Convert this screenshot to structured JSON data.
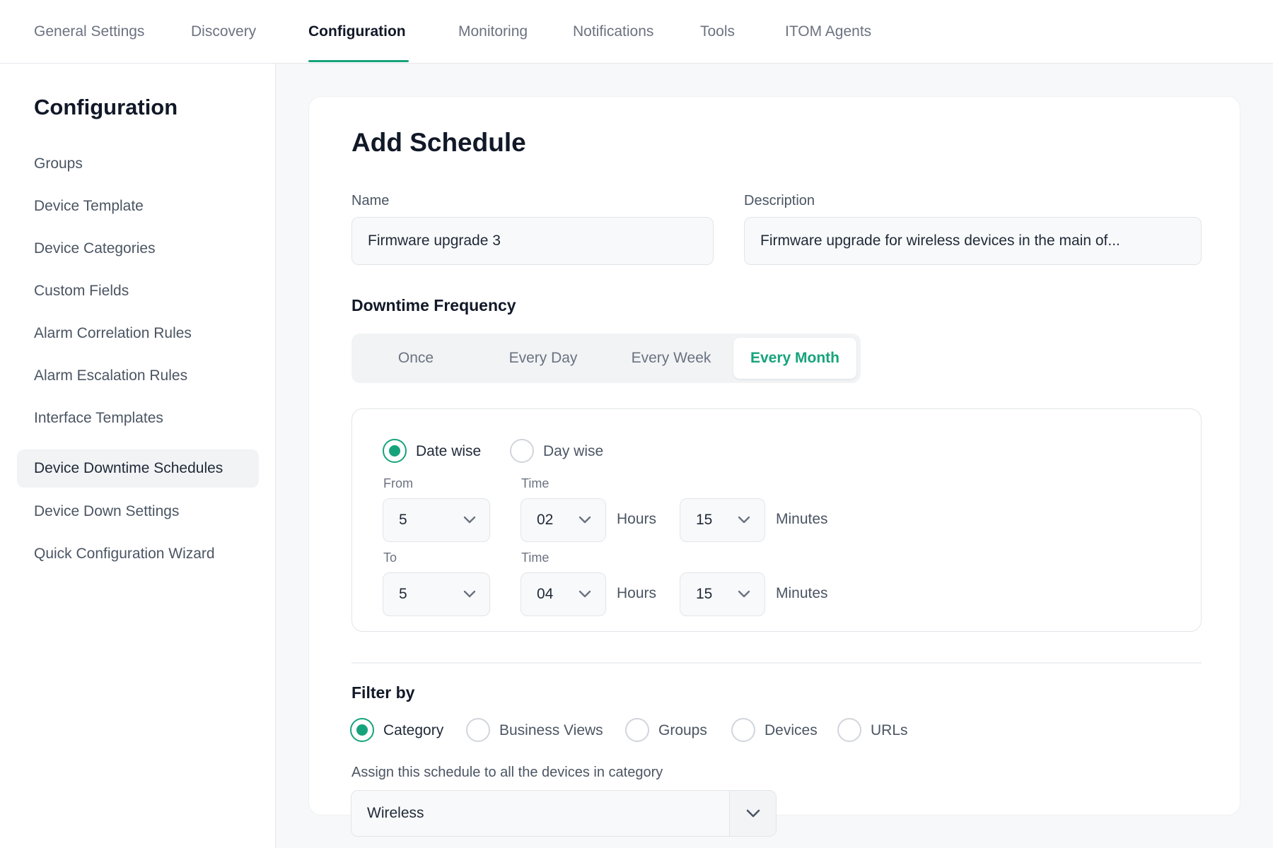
{
  "topnav": {
    "tabs": [
      {
        "label": "General Settings"
      },
      {
        "label": "Discovery"
      },
      {
        "label": "Configuration"
      },
      {
        "label": "Monitoring"
      },
      {
        "label": "Notifications"
      },
      {
        "label": "Tools"
      },
      {
        "label": "ITOM Agents"
      }
    ],
    "active_tab": "Configuration"
  },
  "sidebar": {
    "title": "Configuration",
    "items": [
      {
        "label": "Groups"
      },
      {
        "label": "Device Template"
      },
      {
        "label": "Device Categories"
      },
      {
        "label": "Custom Fields"
      },
      {
        "label": "Alarm Correlation Rules"
      },
      {
        "label": "Alarm Escalation Rules"
      },
      {
        "label": "Interface Templates"
      },
      {
        "label": "Device Downtime Schedules"
      },
      {
        "label": "Device Down Settings"
      },
      {
        "label": "Quick Configuration Wizard"
      }
    ],
    "active_item": "Device Downtime Schedules"
  },
  "form": {
    "title": "Add Schedule",
    "name_label": "Name",
    "name_value": "Firmware upgrade 3",
    "description_label": "Description",
    "description_value": "Firmware upgrade for wireless devices in the main of...",
    "frequency_heading": "Downtime Frequency",
    "frequency_options": [
      "Once",
      "Every Day",
      "Every Week",
      "Every Month"
    ],
    "frequency_selected": "Every Month",
    "mode_options": [
      "Date wise",
      "Day wise"
    ],
    "mode_selected": "Date wise",
    "from_label": "From",
    "to_label": "To",
    "time_label": "Time",
    "hours_unit": "Hours",
    "minutes_unit": "Minutes",
    "from": {
      "date": "5",
      "hours": "02",
      "minutes": "15"
    },
    "to": {
      "date": "5",
      "hours": "04",
      "minutes": "15"
    },
    "filter_heading": "Filter by",
    "filter_options": [
      "Category",
      "Business Views",
      "Groups",
      "Devices",
      "URLs"
    ],
    "filter_selected": "Category",
    "assign_label": "Assign this schedule to all the devices in category",
    "assign_value": "Wireless"
  },
  "colors": {
    "accent": "#16a37b",
    "text_dark": "#111827",
    "text_muted": "#6b7280",
    "background": "#f7f8f9"
  }
}
